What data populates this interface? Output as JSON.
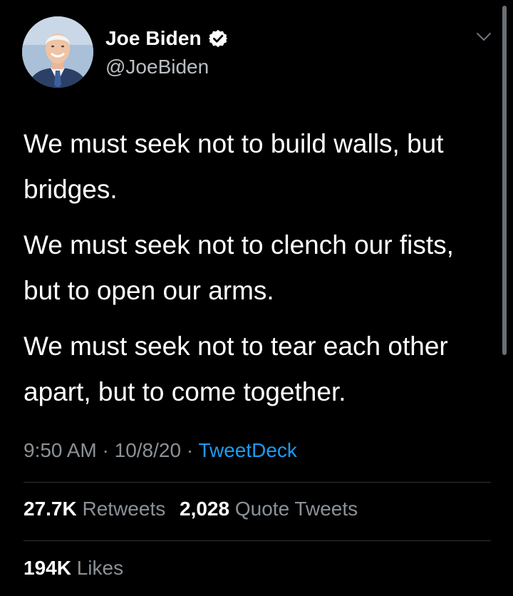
{
  "author": {
    "display_name": "Joe Biden",
    "handle": "@JoeBiden",
    "verified": true
  },
  "tweet": {
    "paragraphs": [
      "We must seek not to build walls, but bridges.",
      "We must seek not to clench our fists, but to open our arms.",
      "We must seek not to tear each other apart, but to come together."
    ],
    "time": "9:50 AM",
    "separator": "·",
    "date": "10/8/20",
    "source": "TweetDeck"
  },
  "stats": {
    "retweets_count": "27.7K",
    "retweets_label": "Retweets",
    "quote_tweets_count": "2,028",
    "quote_tweets_label": "Quote Tweets",
    "likes_count": "194K",
    "likes_label": "Likes"
  },
  "icons": {
    "verified": "verified-badge-icon",
    "caret": "chevron-down-icon"
  },
  "colors": {
    "background": "#000000",
    "link": "#1d9bf0",
    "secondary_text": "#8b9196"
  }
}
